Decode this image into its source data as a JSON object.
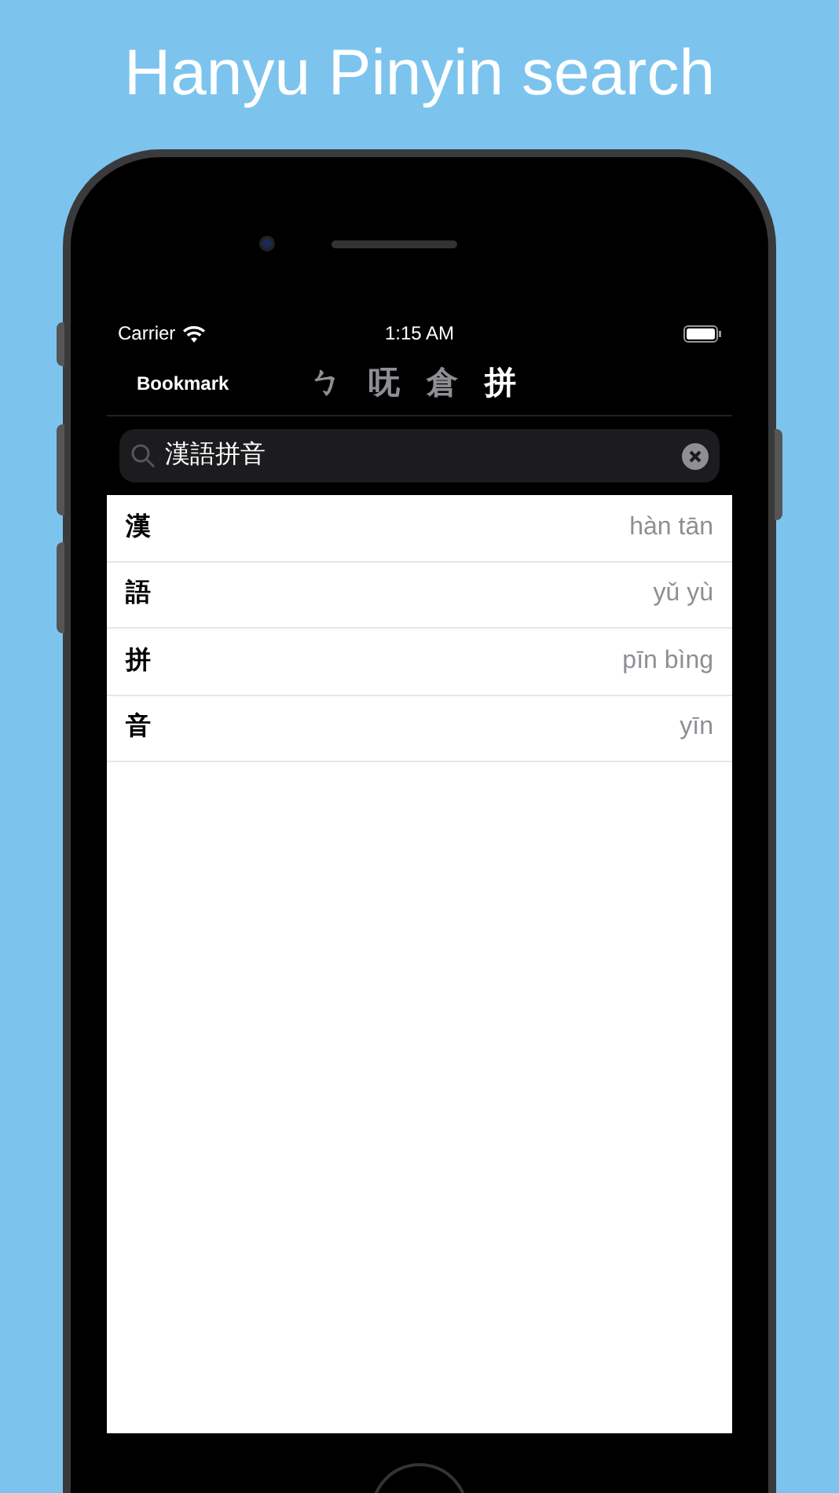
{
  "headline": "Hanyu Pinyin search",
  "status_bar": {
    "carrier": "Carrier",
    "time": "1:15 AM"
  },
  "nav": {
    "bookmark": "Bookmark",
    "tabs": [
      {
        "label": "ㄅ",
        "selected": false
      },
      {
        "label": "呒",
        "selected": false
      },
      {
        "label": "倉",
        "selected": false
      },
      {
        "label": "拼",
        "selected": true
      }
    ]
  },
  "search": {
    "value": "漢語拼音"
  },
  "rows": [
    {
      "character": "漢",
      "pinyin": "hàn tān"
    },
    {
      "character": "語",
      "pinyin": "yǔ yù"
    },
    {
      "character": "拼",
      "pinyin": "pīn bìng"
    },
    {
      "character": "音",
      "pinyin": "yīn"
    }
  ]
}
